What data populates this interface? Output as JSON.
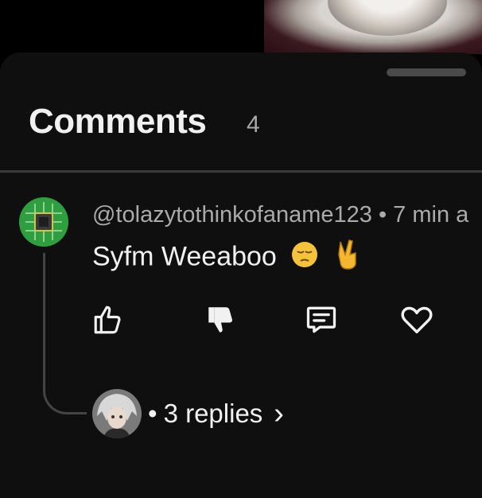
{
  "video": {
    "thumbnail_icon": "video-thumbnail"
  },
  "comments": {
    "title": "Comments",
    "count": "4"
  },
  "comment": {
    "author": "@tolazytothinkofaname123",
    "separator": "•",
    "time": "7 min a",
    "text": "Syfm Weeaboo",
    "emojis": [
      "pensive-face-emoji",
      "victory-hand-emoji"
    ]
  },
  "actions": {
    "like_icon": "thumbs-up-icon",
    "dislike_icon": "thumbs-down-icon",
    "reply_icon": "reply-icon",
    "heart_icon": "heart-icon"
  },
  "replies": {
    "separator": "•",
    "label": "3 replies",
    "chevron": "›"
  },
  "colors": {
    "background": "#0f0f0f",
    "text_primary": "#f1f1f1",
    "text_secondary": "#aaaaaa",
    "avatar_green": "#2e9e3e"
  }
}
